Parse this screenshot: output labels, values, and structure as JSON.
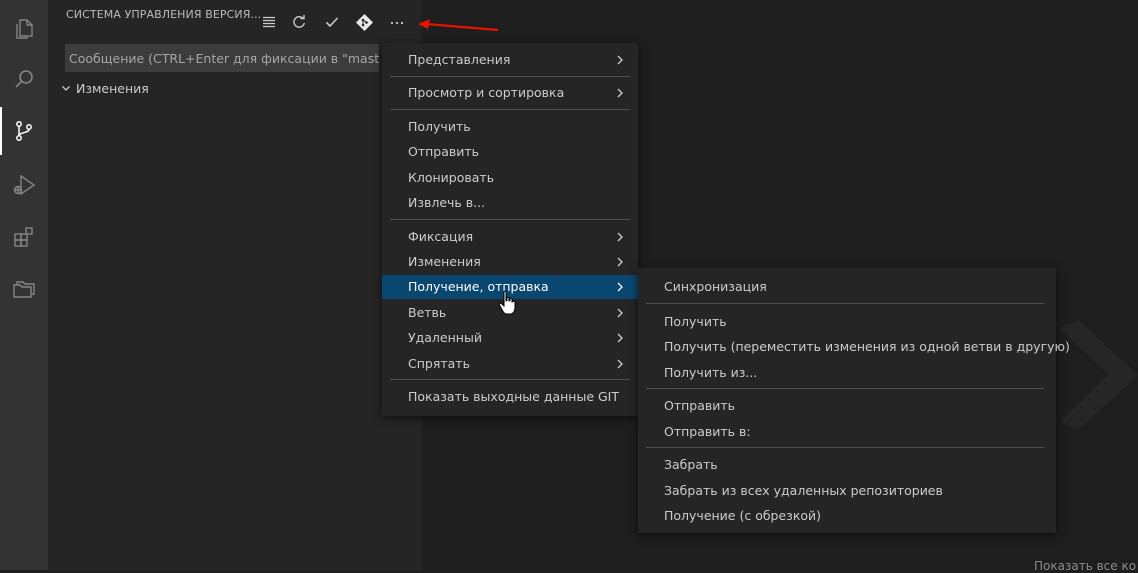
{
  "sidebar": {
    "title": "СИСТЕМА УПРАВЛЕНИЯ ВЕРСИЯ...",
    "commit_placeholder": "Сообщение (CTRL+Enter для фиксации в \"master\")",
    "changes_label": "Изменения"
  },
  "activity_icons": [
    "explorer-icon",
    "search-icon",
    "source-control-icon",
    "run-debug-icon",
    "extensions-icon",
    "remote-explorer-icon"
  ],
  "toolbar_icons": [
    "list-icon",
    "refresh-icon",
    "check-icon",
    "git-icon",
    "more-icon"
  ],
  "main_menu": {
    "items": [
      {
        "label": "Представления",
        "submenu": true
      },
      {
        "label": "Просмотр и сортировка",
        "submenu": true
      },
      {
        "label": "Получить",
        "submenu": false
      },
      {
        "label": "Отправить",
        "submenu": false
      },
      {
        "label": "Клонировать",
        "submenu": false
      },
      {
        "label": "Извлечь в...",
        "submenu": false
      },
      {
        "label": "Фиксация",
        "submenu": true
      },
      {
        "label": "Изменения",
        "submenu": true
      },
      {
        "label": "Получение, отправка",
        "submenu": true,
        "selected": true
      },
      {
        "label": "Ветвь",
        "submenu": true
      },
      {
        "label": "Удаленный",
        "submenu": true
      },
      {
        "label": "Спрятать",
        "submenu": true
      },
      {
        "label": "Показать выходные данные GIT",
        "submenu": false
      }
    ]
  },
  "sub_menu": {
    "items": [
      {
        "label": "Синхронизация"
      },
      {
        "label": "Получить"
      },
      {
        "label": "Получить (переместить изменения из одной ветви в другую)"
      },
      {
        "label": "Получить из..."
      },
      {
        "label": "Отправить"
      },
      {
        "label": "Отправить в:"
      },
      {
        "label": "Забрать"
      },
      {
        "label": "Забрать из всех удаленных репозиториев"
      },
      {
        "label": "Получение (с обрезкой)"
      }
    ]
  },
  "footer": {
    "partial_text": "Показать все ко"
  },
  "colors": {
    "selected_bg": "#094771",
    "annotation_arrow": "#e51400"
  }
}
